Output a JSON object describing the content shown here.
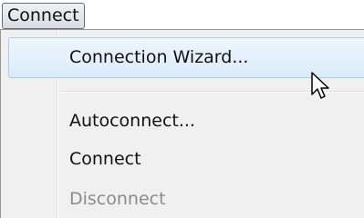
{
  "menubar": {
    "connect_label": "Connect"
  },
  "menu": {
    "items": [
      {
        "label": "Connection Wizard...",
        "state": "highlighted"
      },
      {
        "label": "Autoconnect...",
        "state": "normal"
      },
      {
        "label": "Connect",
        "state": "normal"
      },
      {
        "label": "Disconnect",
        "state": "disabled"
      }
    ]
  },
  "colors": {
    "highlight_border": "#a8cdeb",
    "highlight_fill": "#dcebfa",
    "menu_background": "#f0f0f0",
    "disabled_text": "#8b8b8b"
  },
  "icons": {
    "cursor": "mouse-pointer-icon"
  }
}
